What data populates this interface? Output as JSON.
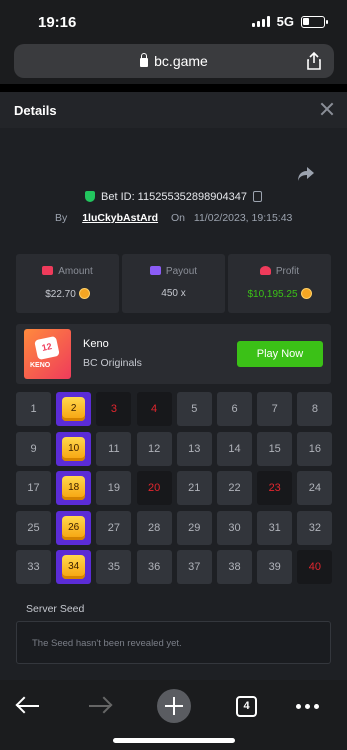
{
  "statusbar": {
    "time": "19:16",
    "network": "5G"
  },
  "browser": {
    "url": "bc.game",
    "tab_count": "4"
  },
  "sheet": {
    "title": "Details",
    "bet_id": "Bet ID: 115255352898904347",
    "by_label": "By",
    "username": "1luCkybAstArd",
    "on_label": "On",
    "date": "11/02/2023, 19:15:43"
  },
  "stats": [
    {
      "label": "Amount",
      "value": "$22.70",
      "color": "#c6c9d0"
    },
    {
      "label": "Payout",
      "value": "450 x",
      "color": "#c6c9d0"
    },
    {
      "label": "Profit",
      "value": "$10,195.25",
      "color": "#3bc117"
    }
  ],
  "game": {
    "name": "Keno",
    "provider": "BC Originals",
    "play_label": "Play Now",
    "thumb_number": "12",
    "thumb_label": "KENO"
  },
  "keno": {
    "numbers": [
      1,
      2,
      3,
      4,
      5,
      6,
      7,
      8,
      9,
      10,
      11,
      12,
      13,
      14,
      15,
      16,
      17,
      18,
      19,
      20,
      21,
      22,
      23,
      24,
      25,
      26,
      27,
      28,
      29,
      30,
      31,
      32,
      33,
      34,
      35,
      36,
      37,
      38,
      39,
      40
    ],
    "hits": [
      2,
      10,
      18,
      26,
      34
    ],
    "misses": [
      3,
      4,
      20,
      23,
      40
    ]
  },
  "seed": {
    "label": "Server Seed",
    "text": "The Seed hasn't been revealed yet."
  },
  "colors": {
    "accent": "#3bc117",
    "hit": "#5b2cd6",
    "gem": "#f6a10c",
    "miss": "#e2262e"
  }
}
